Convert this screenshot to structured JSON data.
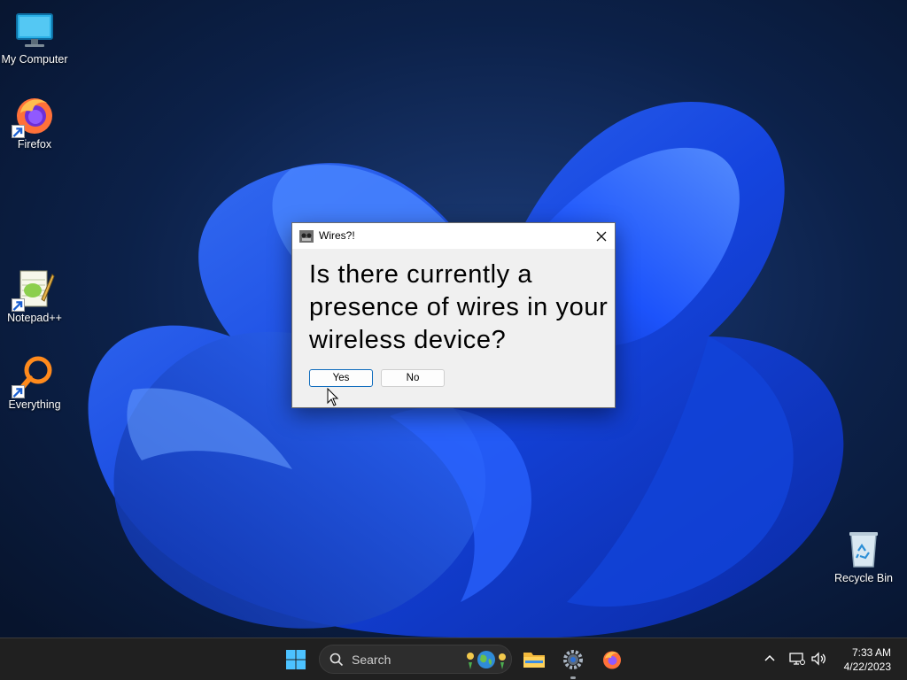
{
  "desktop": {
    "icons": [
      {
        "label": "My Computer",
        "icon": "monitor-icon"
      },
      {
        "label": "Firefox",
        "icon": "firefox-icon"
      },
      {
        "label": "Notepad++",
        "icon": "notepadpp-icon"
      },
      {
        "label": "Everything",
        "icon": "everything-search-icon"
      },
      {
        "label": "Recycle Bin",
        "icon": "recycle-bin-icon"
      }
    ]
  },
  "dialog": {
    "title": "Wires?!",
    "question": "Is there currently a presence of wires in your wireless device?",
    "yes_label": "Yes",
    "no_label": "No",
    "default_button": "Yes"
  },
  "taskbar": {
    "search_placeholder": "Search",
    "pinned": [
      "windows-start-icon",
      "file-explorer-icon",
      "settings-gear-icon",
      "firefox-icon"
    ],
    "time": "7:33 AM",
    "date": "4/22/2023"
  },
  "colors": {
    "accent": "#0f6cbd",
    "taskbar": "#202020",
    "wallpaper_bloom": "#1a4cff"
  }
}
